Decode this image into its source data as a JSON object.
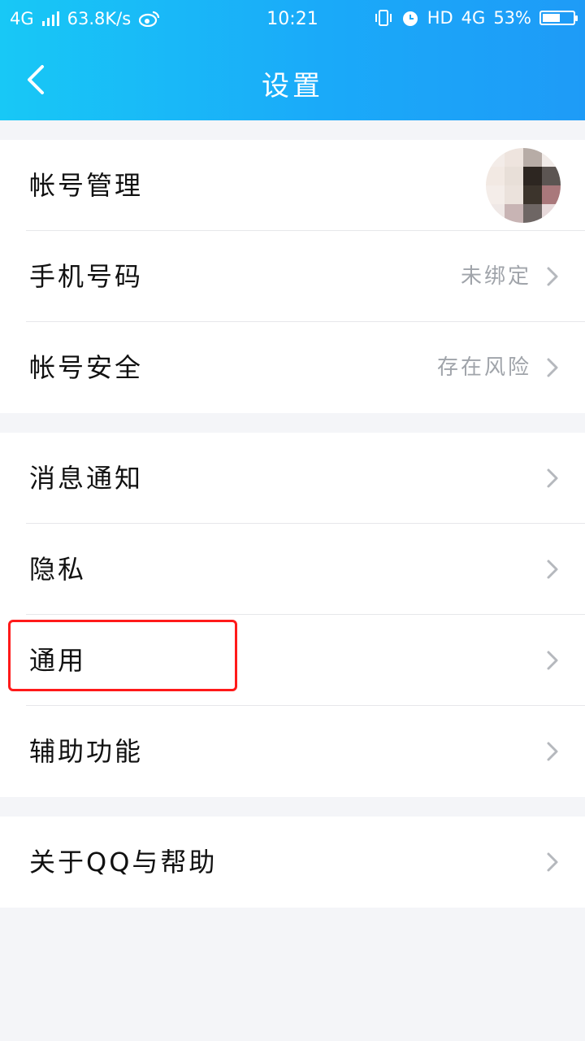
{
  "status_bar": {
    "network": "4G",
    "speed": "63.8K/s",
    "weibo_icon": "weibo-icon",
    "time": "10:21",
    "hd": "HD",
    "network2": "4G",
    "battery": "53%"
  },
  "header": {
    "title": "设置",
    "back_icon": "chevron-left-icon"
  },
  "group1": {
    "account_label": "帐号管理",
    "phone_label": "手机号码",
    "phone_value": "未绑定",
    "security_label": "帐号安全",
    "security_value": "存在风险"
  },
  "group2": {
    "notify_label": "消息通知",
    "privacy_label": "隐私",
    "general_label": "通用",
    "accessibility_label": "辅助功能"
  },
  "group3": {
    "about_label": "关于QQ与帮助"
  },
  "colors": {
    "header_gradient_start": "#18c8f6",
    "header_gradient_end": "#1e9bf7",
    "highlight": "#ff1a1a"
  }
}
